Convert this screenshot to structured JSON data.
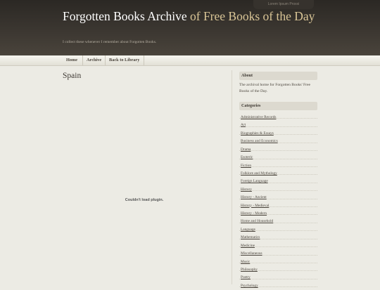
{
  "header": {
    "tab_label": "Lorem Ipsum Proxxi",
    "title_main": "Forgotten Books Archive",
    "title_accent": "of Free Books of the Day",
    "tagline": "I collect these whenever I remember about Forgotten Books."
  },
  "nav": {
    "items": [
      "Home",
      "Archive",
      "Back to Library"
    ]
  },
  "main": {
    "title": "Spain",
    "plugin_message": "Couldn't load plugin."
  },
  "sidebar": {
    "about_heading": "About",
    "about_text": "The archival home for Forgotten Books' Free Books of the Day.",
    "categories_heading": "Categories",
    "categories": [
      "Administrative Records",
      "Art",
      "Biographies & Essays",
      "Business and Economics",
      "Drama",
      "Esoteric",
      "Fiction",
      "Folklore and Mythology",
      "Foreign Language",
      "History",
      "History - Ancient",
      "History - Medieval",
      "History - Modern",
      "Home and Household",
      "Language",
      "Mathematics",
      "Medicine",
      "Miscellaneous",
      "Music",
      "Philosophy",
      "Poetry",
      "Psychology"
    ]
  }
}
